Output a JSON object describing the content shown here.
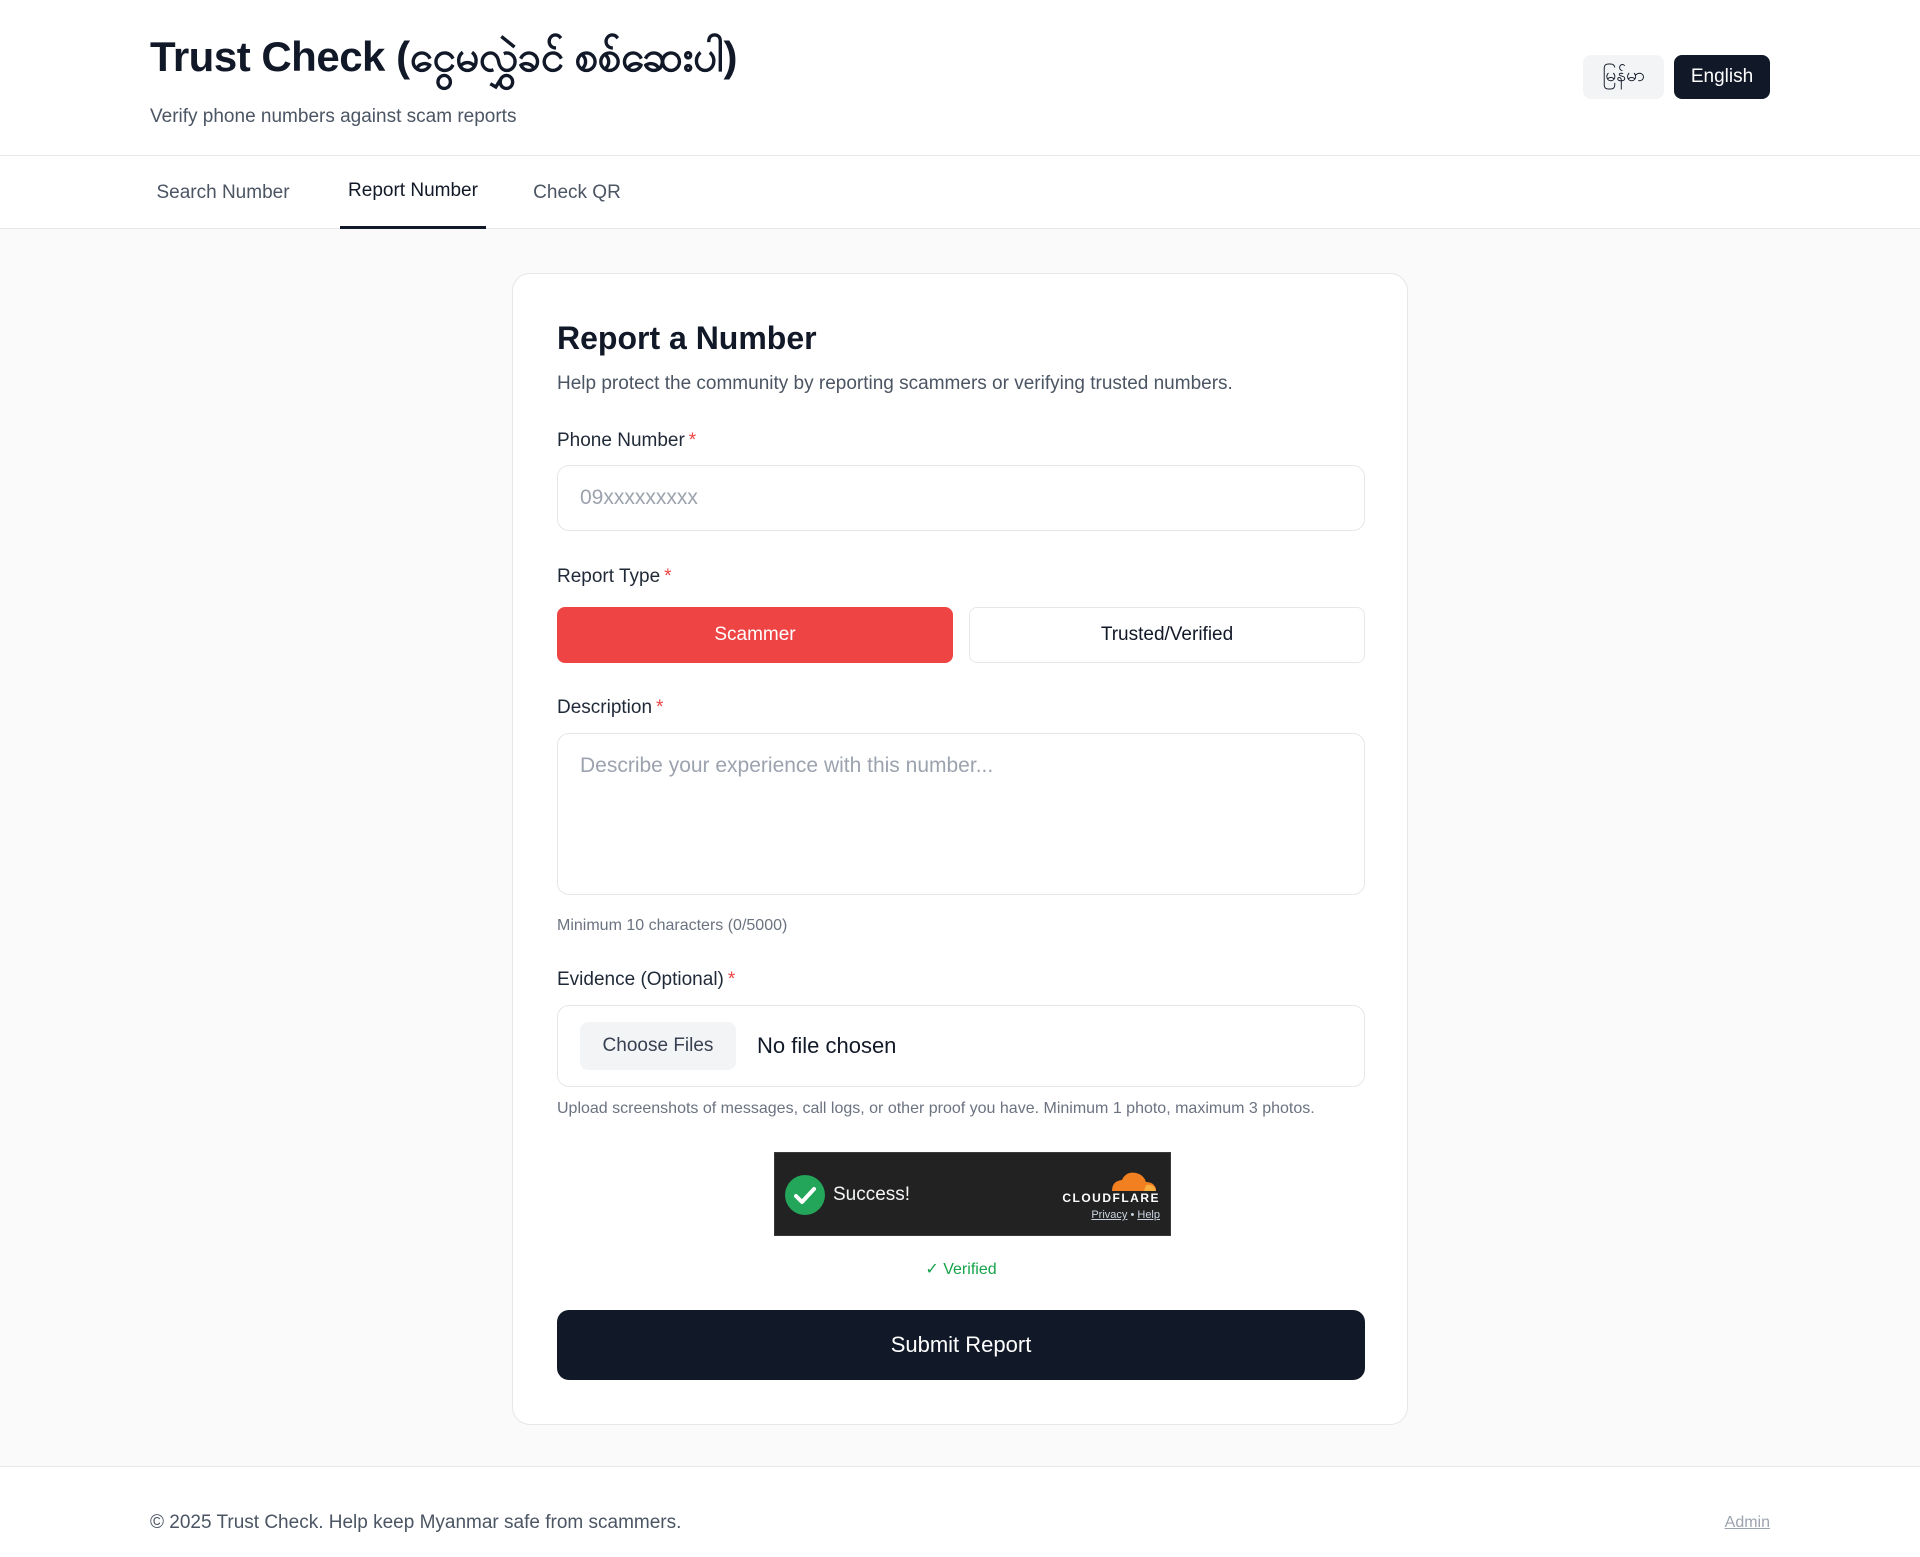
{
  "header": {
    "title": "Trust Check (ငွေမလွှဲခင် စစ်ဆေးပါ)",
    "subtitle": "Verify phone numbers against scam reports",
    "languages": [
      {
        "label": "မြန်မာ",
        "active": false
      },
      {
        "label": "English",
        "active": true
      }
    ]
  },
  "tabs": [
    {
      "label": "Search Number",
      "active": false
    },
    {
      "label": "Report Number",
      "active": true
    },
    {
      "label": "Check QR",
      "active": false
    }
  ],
  "form": {
    "title": "Report a Number",
    "description": "Help protect the community by reporting scammers or verifying trusted numbers.",
    "phone": {
      "label": "Phone Number",
      "required_mark": "*",
      "placeholder": "09xxxxxxxxx",
      "value": ""
    },
    "report_type": {
      "label": "Report Type",
      "required_mark": "*",
      "options": [
        "Scammer",
        "Trusted/Verified"
      ],
      "selected": "Scammer"
    },
    "description_field": {
      "label": "Description",
      "required_mark": "*",
      "placeholder": "Describe your experience with this number...",
      "value": "",
      "helper": "Minimum 10 characters (0/5000)"
    },
    "evidence": {
      "label": "Evidence (Optional)",
      "required_mark": "*",
      "button": "Choose Files",
      "status": "No file chosen",
      "helper": "Upload screenshots of messages, call logs, or other proof you have. Minimum 1 photo, maximum 3 photos."
    },
    "captcha": {
      "status": "Success!",
      "brand": "CLOUDFLARE",
      "privacy": "Privacy",
      "separator": "•",
      "help": "Help",
      "verified": "✓ Verified"
    },
    "submit": "Submit Report"
  },
  "footer": {
    "copyright": "© 2025 Trust Check. Help keep Myanmar safe from scammers.",
    "admin": "Admin"
  },
  "colors": {
    "primary": "#111827",
    "danger": "#ef4444",
    "success": "#16a34a",
    "cloudflare_orange": "#f38020"
  }
}
